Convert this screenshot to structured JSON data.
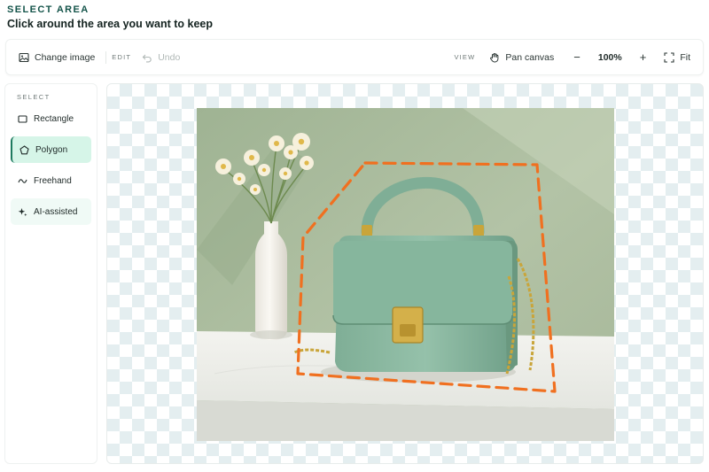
{
  "header": {
    "eyebrow": "SELECT AREA",
    "title": "Click around the area you want to keep"
  },
  "toolbar": {
    "change_image": "Change image",
    "edit_label": "EDIT",
    "undo": "Undo",
    "view_label": "VIEW",
    "pan_canvas": "Pan canvas",
    "zoom_out": "−",
    "zoom_value": "100%",
    "zoom_in": "+",
    "fit": "Fit"
  },
  "sidebar": {
    "section_label": "SELECT",
    "tools": [
      {
        "label": "Rectangle",
        "icon": "rectangle-icon"
      },
      {
        "label": "Polygon",
        "icon": "polygon-icon",
        "active": true
      },
      {
        "label": "Freehand",
        "icon": "freehand-icon"
      },
      {
        "label": "AI-assisted",
        "icon": "sparkle-icon"
      }
    ]
  },
  "colors": {
    "accent": "#1e7a5f",
    "active_tool_bg": "#d6f5e8",
    "selection_stroke": "#f07020",
    "eyebrow": "#14544a"
  }
}
